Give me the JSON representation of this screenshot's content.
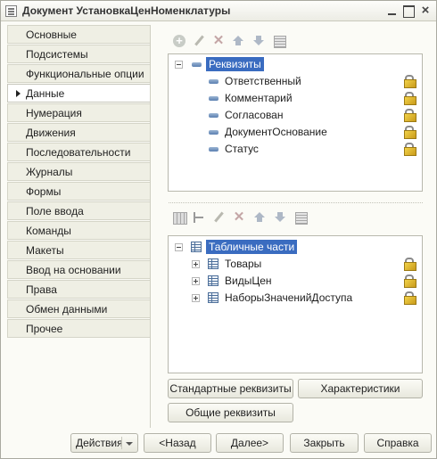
{
  "window": {
    "title": "Документ УстановкаЦенНоменклатуры"
  },
  "tabs": [
    {
      "label": "Основные"
    },
    {
      "label": "Подсистемы"
    },
    {
      "label": "Функциональные опции"
    },
    {
      "label": "Данные",
      "active": true
    },
    {
      "label": "Нумерация"
    },
    {
      "label": "Движения"
    },
    {
      "label": "Последовательности"
    },
    {
      "label": "Журналы"
    },
    {
      "label": "Формы"
    },
    {
      "label": "Поле ввода"
    },
    {
      "label": "Команды"
    },
    {
      "label": "Макеты"
    },
    {
      "label": "Ввод на основании"
    },
    {
      "label": "Права"
    },
    {
      "label": "Обмен данными"
    },
    {
      "label": "Прочее"
    }
  ],
  "attributes_tree": {
    "root": "Реквизиты",
    "items": [
      {
        "label": "Ответственный"
      },
      {
        "label": "Комментарий"
      },
      {
        "label": "Согласован"
      },
      {
        "label": "ДокументОснование"
      },
      {
        "label": "Статус"
      }
    ]
  },
  "tabular_tree": {
    "root": "Табличные части",
    "items": [
      {
        "label": "Товары"
      },
      {
        "label": "ВидыЦен"
      },
      {
        "label": "НаборыЗначенийДоступа"
      }
    ]
  },
  "buttons": {
    "standard_attributes": "Стандартные реквизиты",
    "characteristics": "Характеристики",
    "common_attributes": "Общие реквизиты"
  },
  "footer": {
    "actions": "Действия",
    "back": "<Назад",
    "next": "Далее>",
    "close": "Закрыть",
    "help": "Справка"
  }
}
